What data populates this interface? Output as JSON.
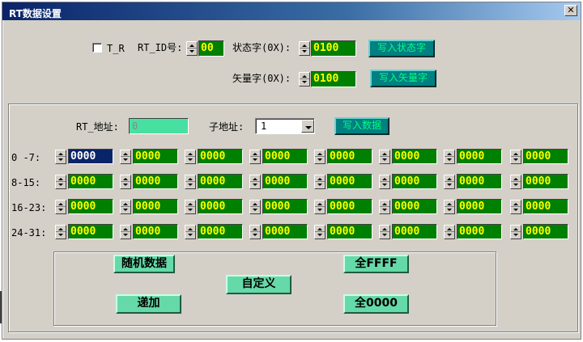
{
  "window": {
    "title": "RT数据设置",
    "close_glyph": "✕"
  },
  "top": {
    "tr_label": "T_R",
    "rt_id_label": "RT_ID号:",
    "rt_id_value": "00",
    "status_label": "状态字(0X):",
    "status_value": "0100",
    "write_status_btn": "写入状态字",
    "vector_label": "矢量字(0X):",
    "vector_value": "0100",
    "write_vector_btn": "写入矢量字"
  },
  "data_section": {
    "rt_addr_label": "RT_地址:",
    "rt_addr_value": "0",
    "sub_addr_label": "子地址:",
    "sub_addr_value": "1",
    "write_data_btn": "写入数据",
    "rows": [
      {
        "label": "0 -7:",
        "values": [
          "0000",
          "0000",
          "0000",
          "0000",
          "0000",
          "0000",
          "0000",
          "0000"
        ]
      },
      {
        "label": "8-15:",
        "values": [
          "0000",
          "0000",
          "0000",
          "0000",
          "0000",
          "0000",
          "0000",
          "0000"
        ]
      },
      {
        "label": "16-23:",
        "values": [
          "0000",
          "0000",
          "0000",
          "0000",
          "0000",
          "0000",
          "0000",
          "0000"
        ]
      },
      {
        "label": "24-31:",
        "values": [
          "0000",
          "0000",
          "0000",
          "0000",
          "0000",
          "0000",
          "0000",
          "0000"
        ]
      }
    ]
  },
  "buttons": {
    "random": "随机数据",
    "custom": "自定义",
    "increment": "递加",
    "all_ffff": "全FFFF",
    "all_0000": "全0000"
  },
  "colors": {
    "value_bg": "#008000",
    "value_fg": "#ffff00",
    "teal_button": "#008080",
    "mint_button": "#66d9a8",
    "title_bar": "#0a246a"
  },
  "icons": [
    "checkbox-icon",
    "spin-up-icon",
    "spin-down-icon",
    "dropdown-arrow-icon",
    "close-icon"
  ]
}
